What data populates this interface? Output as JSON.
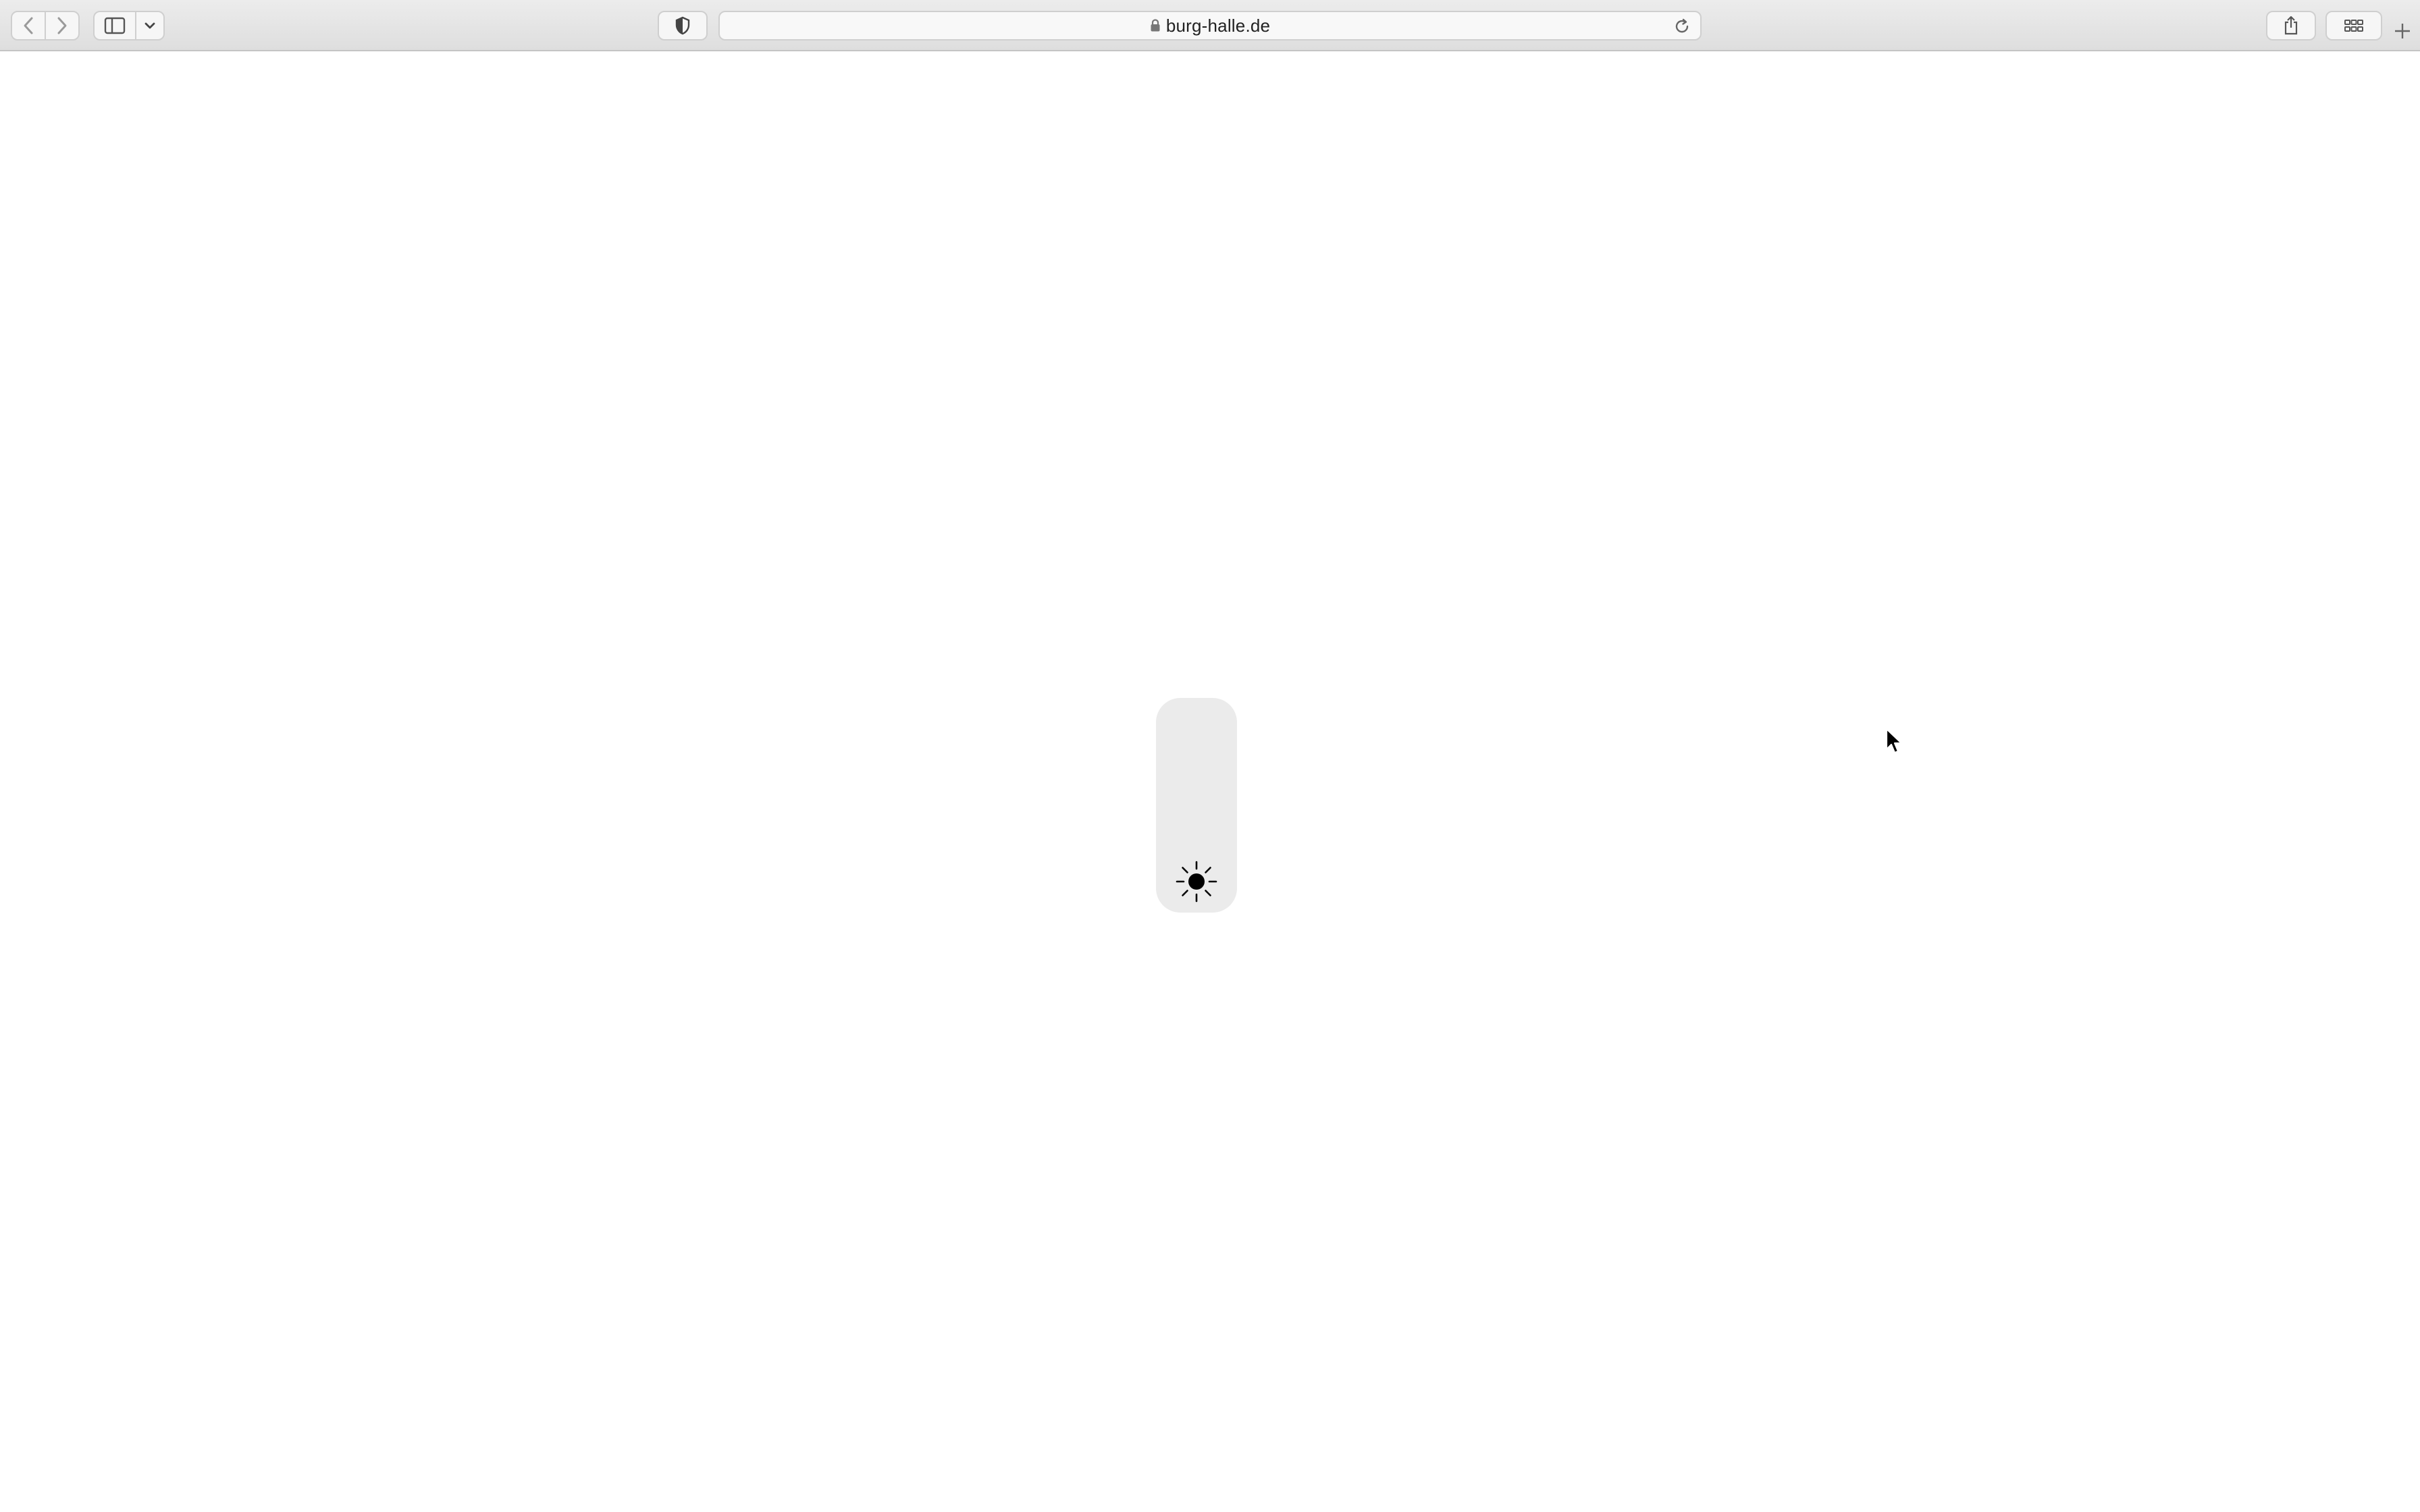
{
  "browser": {
    "address_bar": {
      "url": "burg-halle.de",
      "secure": true
    },
    "toolbar_icons": [
      "chevron-left-icon",
      "chevron-right-icon",
      "sidebar-icon",
      "chevron-down-icon",
      "shield-icon",
      "lock-icon",
      "reload-icon",
      "share-icon",
      "grid-icon",
      "plus-icon"
    ]
  },
  "page": {
    "theme_toggle": {
      "icon": "sun-icon",
      "mode": "light"
    }
  },
  "colors": {
    "toolbar": "#e3e3e3",
    "pill": "#ebebeb",
    "page": "#ffffff"
  }
}
